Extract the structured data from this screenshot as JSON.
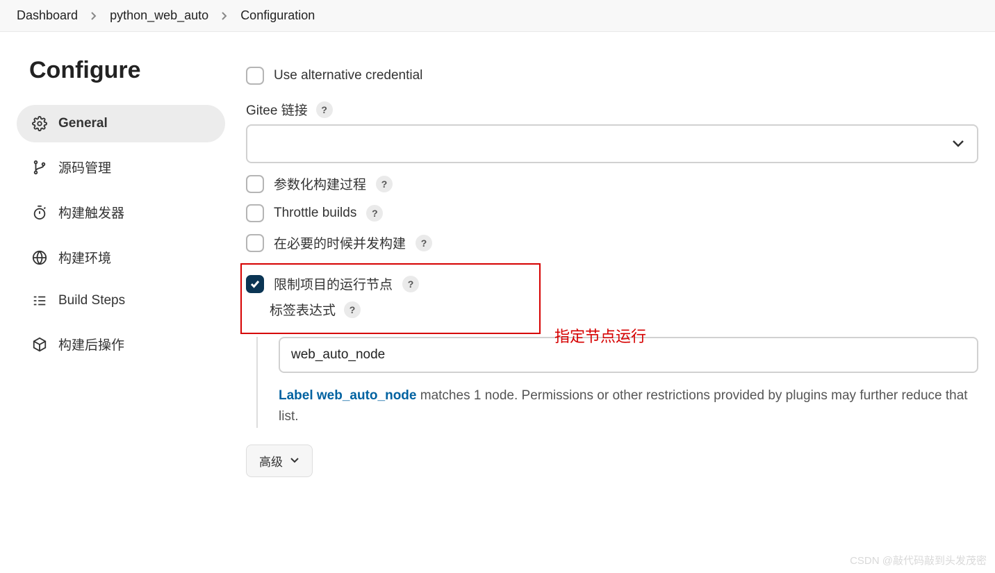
{
  "breadcrumb": {
    "items": [
      "Dashboard",
      "python_web_auto",
      "Configuration"
    ]
  },
  "sidebar": {
    "title": "Configure",
    "tabs": [
      {
        "label": "General"
      },
      {
        "label": "源码管理"
      },
      {
        "label": "构建触发器"
      },
      {
        "label": "构建环境"
      },
      {
        "label": "Build Steps"
      },
      {
        "label": "构建后操作"
      }
    ]
  },
  "form": {
    "alt_cred_label": "Use alternative credential",
    "gitee_label": "Gitee 链接",
    "param_build_label": "参数化构建过程",
    "throttle_label": "Throttle builds",
    "concurrent_label": "在必要的时候并发构建",
    "restrict_label": "限制项目的运行节点",
    "label_expr_label": "标签表达式",
    "label_expr_value": "web_auto_node",
    "hint_prefix": "Label web_auto_node",
    "hint_rest": " matches 1 node. Permissions or other restrictions provided by plugins may further reduce that list.",
    "advanced_label": "高级"
  },
  "annotation": "指定节点运行",
  "watermark": "CSDN @敲代码敲到头发茂密"
}
